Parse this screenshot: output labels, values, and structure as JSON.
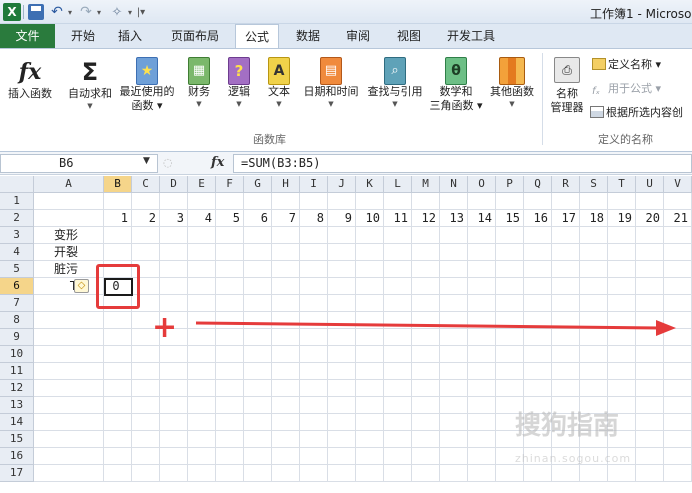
{
  "quick_access": {
    "app_icon": "X",
    "icons": [
      "excel-icon",
      "save-icon",
      "undo-icon",
      "redo-icon",
      "format-painter-icon"
    ]
  },
  "window": {
    "title": "工作簿1 - Microso"
  },
  "tabs": [
    {
      "label": "文件",
      "active": false,
      "file": true
    },
    {
      "label": "开始",
      "active": false
    },
    {
      "label": "插入",
      "active": false
    },
    {
      "label": "页面布局",
      "active": false
    },
    {
      "label": "公式",
      "active": true
    },
    {
      "label": "数据",
      "active": false
    },
    {
      "label": "审阅",
      "active": false
    },
    {
      "label": "视图",
      "active": false
    },
    {
      "label": "开发工具",
      "active": false
    }
  ],
  "ribbon": {
    "insert_function": "插入函数",
    "autosum": "自动求和",
    "recent": "最近使用的\n函数",
    "recent_l1": "最近使用的",
    "recent_l2": "函数",
    "financial": "财务",
    "logical": "逻辑",
    "text": "文本",
    "datetime": "日期和时间",
    "lookup": "查找与引用",
    "math_l1": "数学和",
    "math_l2": "三角函数",
    "other": "其他函数",
    "library_group": "函数库",
    "name_manager_l1": "名称",
    "name_manager_l2": "管理器",
    "define_name": "定义名称",
    "use_in_formula": "用于公式",
    "create_from_selection": "根据所选内容创",
    "names_group": "定义的名称",
    "fx_symbol": "fx",
    "sigma_symbol": "Σ"
  },
  "formula_bar": {
    "name_box": "B6",
    "fx_label": "fx",
    "formula": "=SUM(B3:B5)"
  },
  "grid": {
    "columns": [
      "A",
      "B",
      "C",
      "D",
      "E",
      "F",
      "G",
      "H",
      "I",
      "J",
      "K",
      "L",
      "M",
      "N",
      "O",
      "P",
      "Q",
      "R",
      "S",
      "T",
      "U",
      "V"
    ],
    "rows": [
      "1",
      "2",
      "3",
      "4",
      "5",
      "6",
      "7",
      "8",
      "9",
      "10",
      "11",
      "12",
      "13",
      "14",
      "15",
      "16",
      "17"
    ],
    "selected_column": "B",
    "selected_row": "6",
    "row2_numbers": [
      "1",
      "2",
      "3",
      "4",
      "5",
      "6",
      "7",
      "8",
      "9",
      "10",
      "11",
      "12",
      "13",
      "14",
      "15",
      "16",
      "17",
      "18",
      "19",
      "20",
      "21"
    ],
    "labels": {
      "A3": "变形",
      "A4": "开裂",
      "A5": "脏污",
      "A6": "TT"
    },
    "B6": "0"
  },
  "annotations": {
    "plus": "+",
    "arrow_color": "#e53b3b"
  },
  "watermark": {
    "brand": "搜狗指南",
    "url": "zhinan.sogou.com"
  },
  "colors": {
    "file_tab": "#2a7b3d",
    "selected_header": "#f5d58a",
    "annotation_red": "#e53b3b"
  }
}
